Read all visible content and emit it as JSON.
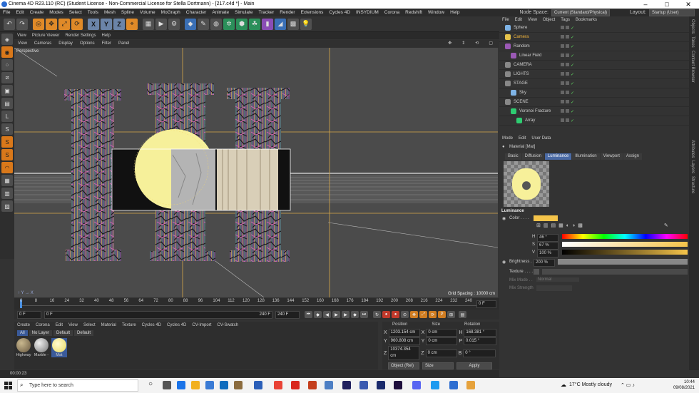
{
  "title_bar": {
    "title": "Cinema 4D R23.110 (RC) (Student License - Non-Commercial License for Stella Dortmann) - [217.c4d *] - Main"
  },
  "menu": {
    "items": [
      "File",
      "Edit",
      "Create",
      "Modes",
      "Select",
      "Tools",
      "Mesh",
      "Spline",
      "Volume",
      "MoGraph",
      "Character",
      "Animate",
      "Simulate",
      "Tracker",
      "Render",
      "Extensions",
      "Cycles 4D",
      "INSYDIUM",
      "Corona",
      "Redshift",
      "Window",
      "Help"
    ],
    "node_space_label": "Node Space:",
    "node_space_value": "Current (Standard/Physical)",
    "layout_label": "Layout:",
    "layout_value": "Startup (User)"
  },
  "toolbar": {
    "icons": [
      "undo-icon",
      "redo-icon",
      "select-icon",
      "move-icon",
      "scale-icon",
      "rotate-icon",
      "x-axis-icon",
      "y-axis-icon",
      "z-axis-icon",
      "coordinate-icon",
      "render-region-icon",
      "render-view-icon",
      "render-settings-icon",
      "cube-icon",
      "pen-icon",
      "subdivision-icon",
      "cloner-icon",
      "array-icon",
      "deformer-icon",
      "field-icon",
      "scene-icon",
      "camera-icon",
      "light-icon"
    ],
    "x_label": "X",
    "y_label": "Y",
    "z_label": "Z"
  },
  "viewport": {
    "tabs": [
      "View",
      "Picture Viewer",
      "Render Settings",
      "Help"
    ],
    "menu": [
      "View",
      "Cameras",
      "Display",
      "Options",
      "Filter",
      "Panel"
    ],
    "label": "Perspective",
    "grid_spacing": "Grid Spacing : 10000 cm"
  },
  "timeline": {
    "ticks": [
      "0",
      "8",
      "16",
      "24",
      "32",
      "40",
      "48",
      "56",
      "64",
      "72",
      "80",
      "88",
      "96",
      "104",
      "112",
      "120",
      "128",
      "136",
      "144",
      "152",
      "160",
      "168",
      "176",
      "184",
      "192",
      "200",
      "208",
      "216",
      "224",
      "232",
      "240"
    ],
    "current_frame": "0 F"
  },
  "playback": {
    "start": "0 F",
    "min": "0 F",
    "end": "240 F",
    "max": "240 F"
  },
  "material_manager": {
    "menu": [
      "Create",
      "Corona",
      "Edit",
      "View",
      "Select",
      "Material",
      "Texture",
      "Cycles 4D",
      "Cycles 4D",
      "CV-Import",
      "CV-Swatch"
    ],
    "filters": [
      "All",
      "No Layer",
      "Default",
      "Default"
    ],
    "materials": [
      {
        "name": "Highway",
        "color": "#8a7a60"
      },
      {
        "name": "Marble -",
        "color": "#bdbdbd"
      },
      {
        "name": "Mat",
        "color": "#f7f09a"
      }
    ]
  },
  "coordinates": {
    "headers": [
      "Position",
      "Size",
      "Rotation"
    ],
    "rows": [
      {
        "axis": "X",
        "pos": "1203.154 cm",
        "size_axis": "X",
        "size": "0 cm",
        "rot_axis": "H",
        "rot": "168.381 °"
      },
      {
        "axis": "Y",
        "pos": "960.808 cm",
        "size_axis": "Y",
        "size": "0 cm",
        "rot_axis": "P",
        "rot": "0.015 °"
      },
      {
        "axis": "Z",
        "pos": "10374.354 cm",
        "size_axis": "Z",
        "size": "0 cm",
        "rot_axis": "B",
        "rot": "0 °"
      }
    ],
    "mode": "Object (Rel)",
    "size_mode": "Size",
    "apply": "Apply"
  },
  "status": {
    "time": "00:00:23"
  },
  "objects": {
    "menu": [
      "File",
      "Edit",
      "View",
      "Object",
      "Tags",
      "Bookmarks"
    ],
    "items": [
      {
        "name": "Sphere",
        "indent": 0,
        "color": "#7fb4e6",
        "highlight": false
      },
      {
        "name": "Camera",
        "indent": 0,
        "color": "#e6c34b",
        "highlight": true
      },
      {
        "name": "Random",
        "indent": 0,
        "color": "#9b59b6",
        "highlight": false
      },
      {
        "name": "Linear Field",
        "indent": 1,
        "color": "#9b59b6",
        "highlight": false
      },
      {
        "name": "CAMERA",
        "indent": 0,
        "color": "#888888",
        "highlight": false
      },
      {
        "name": "LIGHTS",
        "indent": 0,
        "color": "#888888",
        "highlight": false
      },
      {
        "name": "STAGE",
        "indent": 0,
        "color": "#888888",
        "highlight": false
      },
      {
        "name": "Sky",
        "indent": 1,
        "color": "#7fb4e6",
        "highlight": false
      },
      {
        "name": "SCENE",
        "indent": 0,
        "color": "#888888",
        "highlight": false
      },
      {
        "name": "Voronoi Fracture",
        "indent": 1,
        "color": "#2ecc71",
        "highlight": false
      },
      {
        "name": "Array",
        "indent": 2,
        "color": "#2ecc71",
        "highlight": false
      }
    ]
  },
  "attributes": {
    "menu": [
      "Mode",
      "Edit",
      "User Data"
    ],
    "material_title": "Material [Mat]",
    "tabs": [
      "Basic",
      "Diffusion",
      "Luminance",
      "Illumination",
      "Viewport",
      "Assign"
    ],
    "active_tab": "Luminance",
    "section": "Luminance",
    "color_label": "Color . . . .",
    "swatch_color": "#f5c44a",
    "h_label": "H",
    "h_value": "46 °",
    "s_label": "S",
    "s_value": "67 %",
    "v_label": "V",
    "v_value": "100 %",
    "brightness_label": "Brightness . .",
    "brightness_value": "200 %",
    "texture_label": "Texture . . . .",
    "mix_mode_label": "Mix Mode . .",
    "mix_mode_value": "Normal",
    "mix_strength_label": "Mix Strength"
  },
  "right_strip": [
    "Objects",
    "Takes",
    "Content Browser",
    "Attributes",
    "Layers",
    "Structure"
  ],
  "taskbar": {
    "search_placeholder": "Type here to search",
    "weather": "17°C  Mostly cloudy",
    "time": "10:44",
    "date": "09/08/2021"
  }
}
